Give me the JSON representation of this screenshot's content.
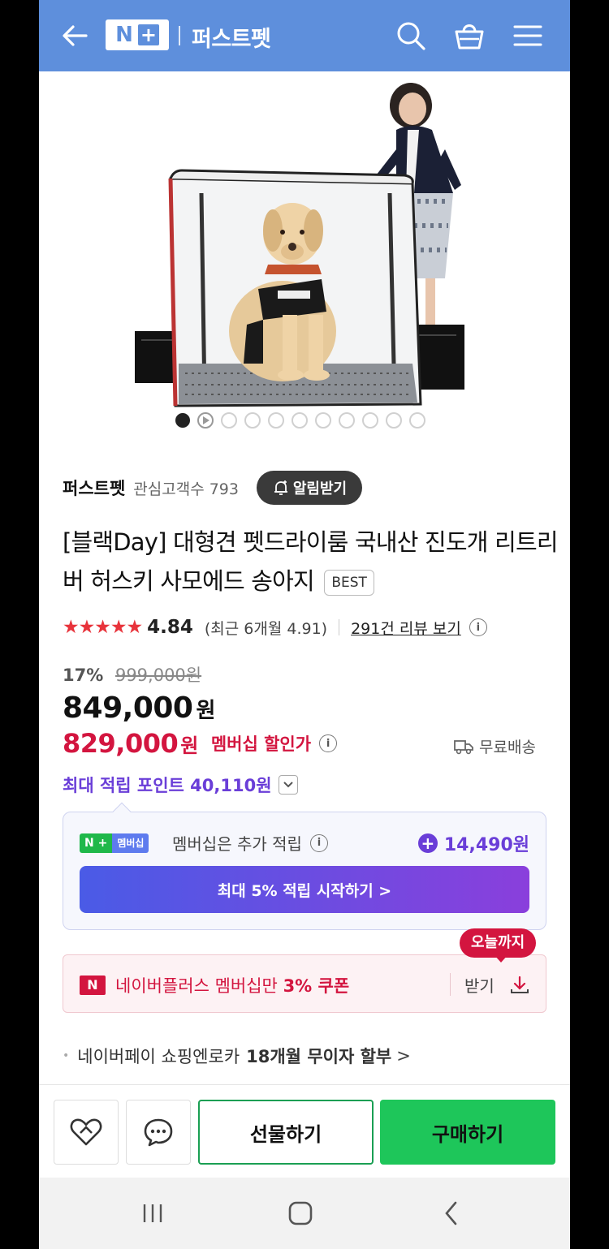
{
  "header": {
    "logo_n": "N",
    "logo_plus": "+",
    "store_title": "퍼스트펫",
    "icons": [
      "back-arrow-icon",
      "search-icon",
      "shopping-bag-icon",
      "menu-icon"
    ],
    "background_color": "#5e8fdc"
  },
  "gallery": {
    "image_name": "pet-dryroom-product-photo",
    "total_slides": 11,
    "active_index": 0,
    "second_is_video": true
  },
  "store": {
    "name": "퍼스트펫",
    "followers_label": "관심고객수 793",
    "alarm_label": "알림받기"
  },
  "product": {
    "title": "[블랙Day] 대형견 펫드라이룸 국내산 진도개 리트리버 허스키 사모에드 송아지",
    "badge": "BEST",
    "stars": "★★★★★",
    "rating": "4.84",
    "recent_rating": "(최근 6개월 4.91)",
    "review_link": "291건 리뷰 보기",
    "info_glyph": "i"
  },
  "price": {
    "discount_pct": "17%",
    "original": "999,000원",
    "sale_amount": "849,000",
    "member_amount": "829,000",
    "currency": "원",
    "member_label": "멤버십 할인가",
    "shipping": "무료배송",
    "max_points": "최대 적립 포인트 40,110원",
    "accent_red": "#d3153f",
    "accent_purple": "#6a3ed8"
  },
  "membership": {
    "badge_left": "N +",
    "badge_right": "멤버십",
    "text": "멤버십은 추가 적립",
    "bonus_plus": "+",
    "bonus": "14,490원",
    "start_button": "최대 5% 적립 시작하기 >"
  },
  "coupon": {
    "icon_letter": "N",
    "text_prefix": "네이버플러스 멤버십만 ",
    "text_bold": "3% 쿠폰",
    "get_label": "받기",
    "until_today": "오늘까지"
  },
  "npay": {
    "bullet": "•",
    "text": "네이버페이 쇼핑엔로카",
    "bold": "18개월 무이자 할부",
    "chevron": ">"
  },
  "actions": {
    "wish_icon": "heart-icon",
    "talk_icon": "chat-icon",
    "gift_label": "선물하기",
    "buy_label": "구매하기",
    "buy_color": "#1ec65a"
  },
  "system_nav": {
    "icons": [
      "recent-apps-icon",
      "home-icon",
      "back-icon"
    ]
  }
}
